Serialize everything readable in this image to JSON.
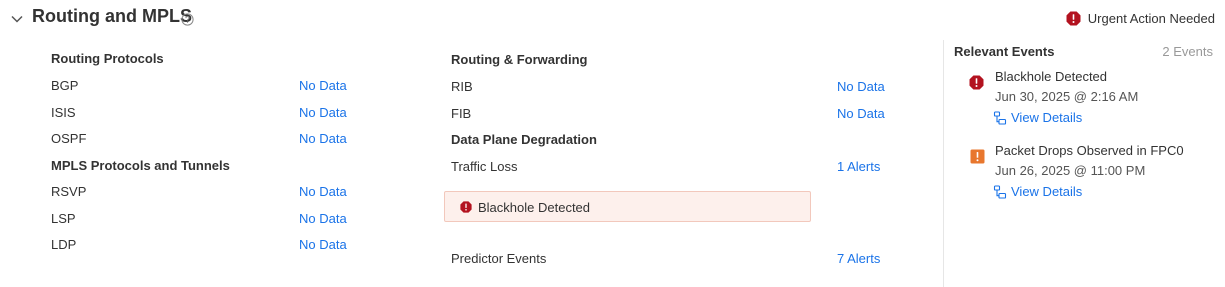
{
  "header": {
    "title": "Routing and MPLS",
    "urgent_label": "Urgent Action Needed",
    "help_icon": "help-circle-icon",
    "collapse_icon": "chevron-down-icon"
  },
  "routing_protocols": {
    "heading": "Routing Protocols",
    "items": [
      {
        "label": "BGP",
        "value": "No Data"
      },
      {
        "label": "ISIS",
        "value": "No Data"
      },
      {
        "label": "OSPF",
        "value": "No Data"
      }
    ]
  },
  "mpls": {
    "heading": "MPLS Protocols and Tunnels",
    "items": [
      {
        "label": "RSVP",
        "value": "No Data"
      },
      {
        "label": "LSP",
        "value": "No Data"
      },
      {
        "label": "LDP",
        "value": "No Data"
      }
    ]
  },
  "routing_forwarding": {
    "heading": "Routing & Forwarding",
    "items": [
      {
        "label": "RIB",
        "value": "No Data"
      },
      {
        "label": "FIB",
        "value": "No Data"
      }
    ]
  },
  "data_plane": {
    "heading": "Data Plane Degradation",
    "traffic_loss_label": "Traffic Loss",
    "traffic_loss_value": "1 Alerts",
    "alert_text": "Blackhole Detected",
    "predictor_label": "Predictor Events",
    "predictor_value": "7 Alerts"
  },
  "relevant_events": {
    "title": "Relevant Events",
    "count": "2 Events",
    "events": [
      {
        "title": "Blackhole Detected",
        "time": "Jun 30, 2025 @ 2:16 AM",
        "link": "View Details",
        "severity_color": "#b3121f",
        "icon": "exclamation-octagon-icon"
      },
      {
        "title": "Packet Drops Observed in FPC0",
        "time": "Jun 26, 2025 @ 11:00 PM",
        "link": "View Details",
        "severity_color": "#e8772e",
        "icon": "exclamation-square-icon"
      }
    ]
  },
  "colors": {
    "link": "#1a73e8",
    "critical": "#b3121f",
    "warning": "#e8772e",
    "alert_bg": "#fdf0ec"
  }
}
